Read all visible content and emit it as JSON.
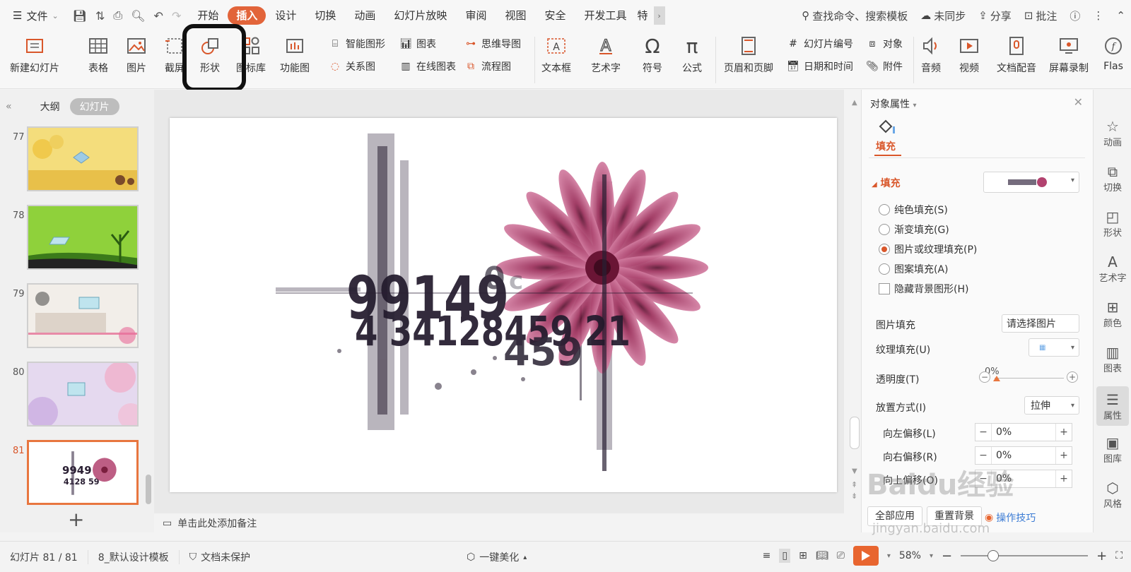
{
  "menubar": {
    "file_label": "文件",
    "tabs": [
      "开始",
      "插入",
      "设计",
      "切换",
      "动画",
      "幻灯片放映",
      "审阅",
      "视图",
      "安全",
      "开发工具",
      "特"
    ],
    "active_tab": "插入",
    "search": "查找命令、搜索模板",
    "sync": "未同步",
    "share": "分享",
    "comment": "批注"
  },
  "ribbon": {
    "new_slide": "新建幻灯片",
    "table": "表格",
    "picture": "图片",
    "screenshot": "截屏",
    "shape": "形状",
    "icon_lib": "图标库",
    "func_chart": "功能图",
    "smart_art": "智能图形",
    "chart": "图表",
    "mind_map": "思维导图",
    "relation": "关系图",
    "online_chart": "在线图表",
    "flowchart": "流程图",
    "textbox": "文本框",
    "art_text": "艺术字",
    "symbol": "符号",
    "formula": "公式",
    "header_footer": "页眉和页脚",
    "slide_num": "幻灯片编号",
    "object": "对象",
    "date_time": "日期和时间",
    "attachment": "附件",
    "audio": "音频",
    "video": "视频",
    "doc_voice": "文档配音",
    "screen_rec": "屏幕录制",
    "flash": "Flas"
  },
  "leftpanel": {
    "outline": "大纲",
    "slides": "幻灯片",
    "thumbs": [
      "77",
      "78",
      "79",
      "80",
      "81"
    ],
    "selected": "81"
  },
  "notes": "单击此处添加备注",
  "props": {
    "title": "对象属性",
    "tab_fill": "填充",
    "section_fill": "填充",
    "options": [
      "纯色填充(S)",
      "渐变填充(G)",
      "图片或纹理填充(P)",
      "图案填充(A)"
    ],
    "hide_bg": "隐藏背景图形(H)",
    "pic_fill_label": "图片填充",
    "pic_fill_btn": "请选择图片",
    "texture_label": "纹理填充(U)",
    "transparency_label": "透明度(T)",
    "transparency_value": "0%",
    "placement_label": "放置方式(I)",
    "placement_value": "拉伸",
    "offset_left_label": "向左偏移(L)",
    "offset_left_value": "0%",
    "offset_right_label": "向右偏移(R)",
    "offset_right_value": "0%",
    "offset_up_label": "向上偏移(O)",
    "offset_up_value": "0%",
    "apply_all": "全部应用",
    "reset_bg": "重置背景",
    "tips": "操作技巧"
  },
  "iconbar": [
    "动画",
    "切换",
    "形状",
    "艺术字",
    "颜色",
    "图表",
    "属性",
    "图库",
    "风格"
  ],
  "status": {
    "slide_pos": "幻灯片 81 / 81",
    "template": "8_默认设计模板",
    "protect": "文档未保护",
    "beautify": "一键美化",
    "zoom": "58%"
  },
  "watermark": {
    "main": "Baidu经验",
    "sub": "jingyan.baidu.com"
  },
  "colors": {
    "accent": "#e2643a",
    "flower": "#b2426f",
    "ink": "#2a1f33"
  }
}
